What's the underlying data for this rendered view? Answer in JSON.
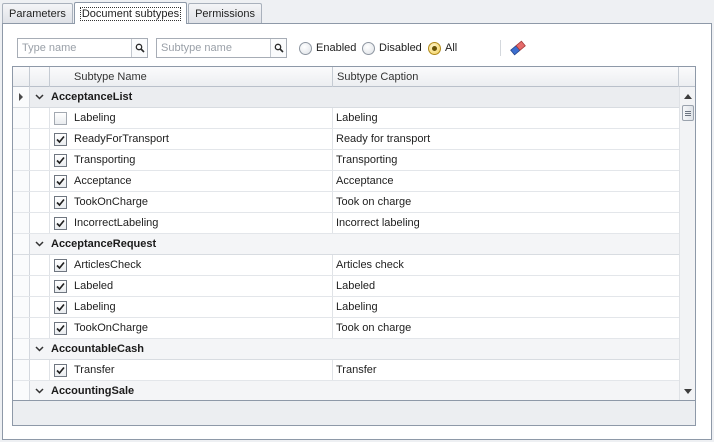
{
  "tabs": [
    {
      "label": "Parameters",
      "active": false
    },
    {
      "label": "Document subtypes",
      "active": true
    },
    {
      "label": "Permissions",
      "active": false
    }
  ],
  "filter": {
    "type_placeholder": "Type name",
    "subtype_placeholder": "Subtype name",
    "radios": [
      {
        "label": "Enabled",
        "checked": false
      },
      {
        "label": "Disabled",
        "checked": false
      },
      {
        "label": "All",
        "checked": true
      }
    ],
    "clear_icon": "eraser-icon",
    "search_icon": "magnifier-icon"
  },
  "grid": {
    "columns": [
      "Subtype Name",
      "Subtype Caption"
    ],
    "groups": [
      {
        "name": "AcceptanceList",
        "expanded": true,
        "rows": [
          {
            "checked": false,
            "name": "Labeling",
            "caption": "Labeling"
          },
          {
            "checked": true,
            "name": "ReadyForTransport",
            "caption": "Ready for transport"
          },
          {
            "checked": true,
            "name": "Transporting",
            "caption": "Transporting"
          },
          {
            "checked": true,
            "name": "Acceptance",
            "caption": "Acceptance"
          },
          {
            "checked": true,
            "name": "TookOnCharge",
            "caption": "Took on charge"
          },
          {
            "checked": true,
            "name": "IncorrectLabeling",
            "caption": "Incorrect labeling"
          }
        ]
      },
      {
        "name": "AcceptanceRequest",
        "expanded": true,
        "rows": [
          {
            "checked": true,
            "name": "ArticlesCheck",
            "caption": "Articles check"
          },
          {
            "checked": true,
            "name": "Labeled",
            "caption": "Labeled"
          },
          {
            "checked": true,
            "name": "Labeling",
            "caption": "Labeling"
          },
          {
            "checked": true,
            "name": "TookOnCharge",
            "caption": "Took on charge"
          }
        ]
      },
      {
        "name": "AccountableCash",
        "expanded": true,
        "rows": [
          {
            "checked": true,
            "name": "Transfer",
            "caption": "Transfer"
          }
        ]
      },
      {
        "name": "AccountingSale",
        "expanded": true,
        "rows": []
      }
    ]
  },
  "colors": {
    "accent": "#f3cf57",
    "border": "#8e99a8",
    "header_bg": "#eceef1"
  }
}
